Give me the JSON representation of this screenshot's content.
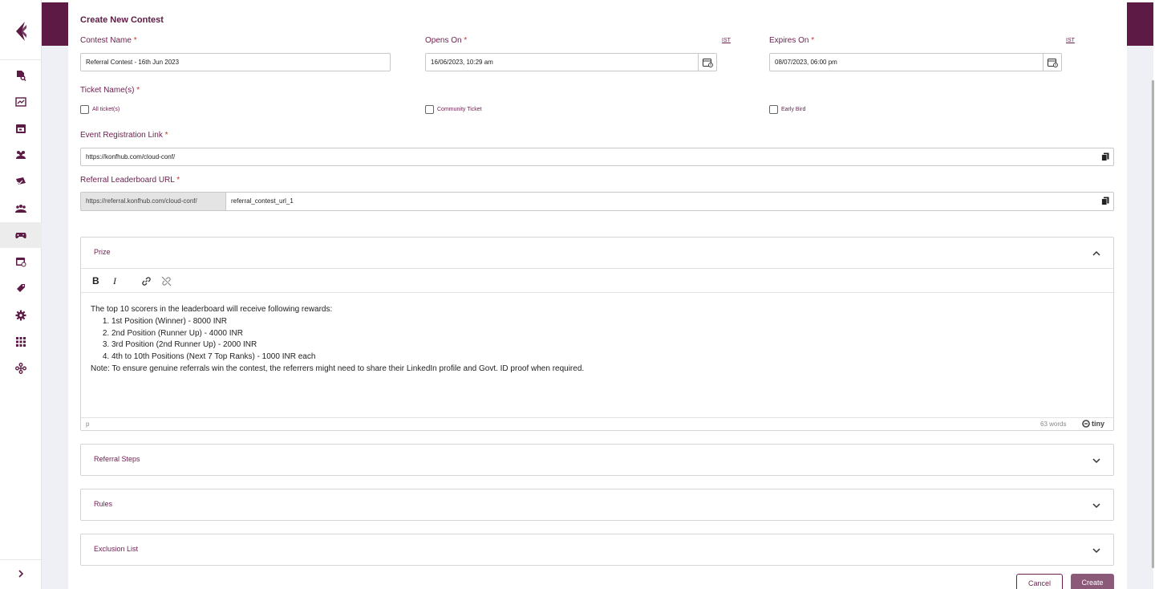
{
  "form": {
    "title": "Create New Contest",
    "contest_name": {
      "label": "Contest Name",
      "required": "*",
      "value": "Referral Contest - 16th Jun 2023"
    },
    "opens_on": {
      "label": "Opens On",
      "required": "*",
      "tz": "IST",
      "value": "16/06/2023, 10:29 am"
    },
    "expires_on": {
      "label": "Expires On",
      "required": "*",
      "tz": "IST",
      "value": "08/07/2023, 06:00 pm"
    },
    "tickets": {
      "label": "Ticket Name(s)",
      "required": "*",
      "options": [
        {
          "label": "All ticket(s)",
          "checked": false
        },
        {
          "label": "Community Ticket",
          "checked": false
        },
        {
          "label": "Early Bird",
          "checked": false
        }
      ]
    },
    "registration_link": {
      "label": "Event Registration Link",
      "required": "*",
      "value": "https://konfhub.com/cloud-conf/"
    },
    "leaderboard_url": {
      "label": "Referral Leaderboard URL",
      "required": "*",
      "prefix": "https://referral.konfhub.com/cloud-conf/",
      "value": "referral_contest_url_1"
    }
  },
  "prize": {
    "title": "Prize",
    "toolbar": {
      "bold": "B",
      "italic": "I"
    },
    "intro": "The top 10 scorers in the leaderboard will receive following rewards:",
    "items": [
      "1st Position (Winner) - 8000 INR",
      "2nd Position (Runner Up) - 4000 INR",
      "3rd Position (2nd Runner Up) - 2000 INR",
      "4th to 10th Positions (Next 7 Top Ranks) - 1000 INR each"
    ],
    "note": "Note: To ensure genuine referrals win the contest, the referrers might need to share their LinkedIn profile and Govt. ID proof when required.",
    "status_path": "p",
    "word_count": "63 words",
    "brand": "tiny"
  },
  "sections": {
    "referral_steps": "Referral Steps",
    "rules": "Rules",
    "exclusion_list": "Exclusion List"
  },
  "actions": {
    "cancel": "Cancel",
    "create": "Create"
  },
  "colors": {
    "brand": "#5c1a44",
    "label": "#6b1f4e",
    "required": "#c0392b",
    "create_bg": "#8a5a78"
  }
}
